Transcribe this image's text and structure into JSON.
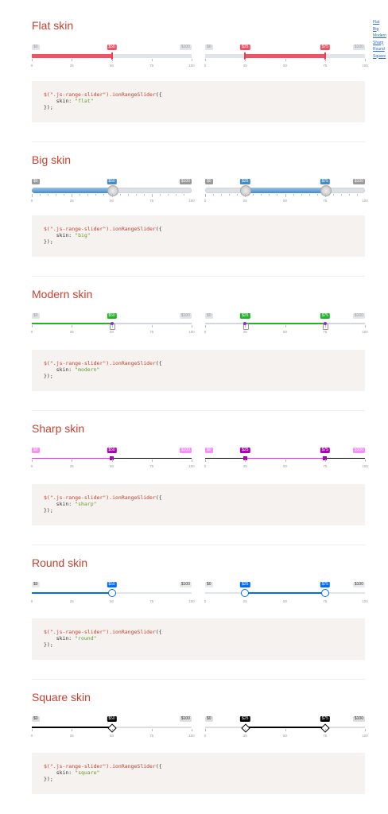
{
  "toc": [
    "Flat",
    "Big",
    "Modern",
    "Sharp",
    "Round",
    "Square"
  ],
  "sections": [
    {
      "key": "flat",
      "title": "Flat skin",
      "accent": "#ed5565",
      "skin_value": "\"flat\""
    },
    {
      "key": "big",
      "title": "Big skin",
      "accent": "#428bca",
      "skin_value": "\"big\""
    },
    {
      "key": "modern",
      "title": "Modern skin",
      "accent": "#20b426",
      "skin_value": "\"modern\""
    },
    {
      "key": "sharp",
      "title": "Sharp skin",
      "accent": "#ee22fa",
      "skin_value": "\"sharp\""
    },
    {
      "key": "round",
      "title": "Round skin",
      "accent": "#006cfa",
      "skin_value": "\"round\""
    },
    {
      "key": "square",
      "title": "Square skin",
      "accent": "#000000",
      "skin_value": "\"square\""
    }
  ],
  "slider": {
    "min_label": "$0",
    "max_label": "$100",
    "single_label": "$50",
    "from_label": "$25",
    "to_label": "$75",
    "single_value": 50,
    "from_value": 25,
    "to_value": 75,
    "ticks": [
      "0",
      "25",
      "50",
      "75",
      "100"
    ]
  },
  "code": {
    "line1_selector": "$(\".js-range-slider\")",
    "line1_method": ".ionRangeSlider",
    "line1_open": "({",
    "line2_key": "skin:",
    "line3_close": "});"
  }
}
